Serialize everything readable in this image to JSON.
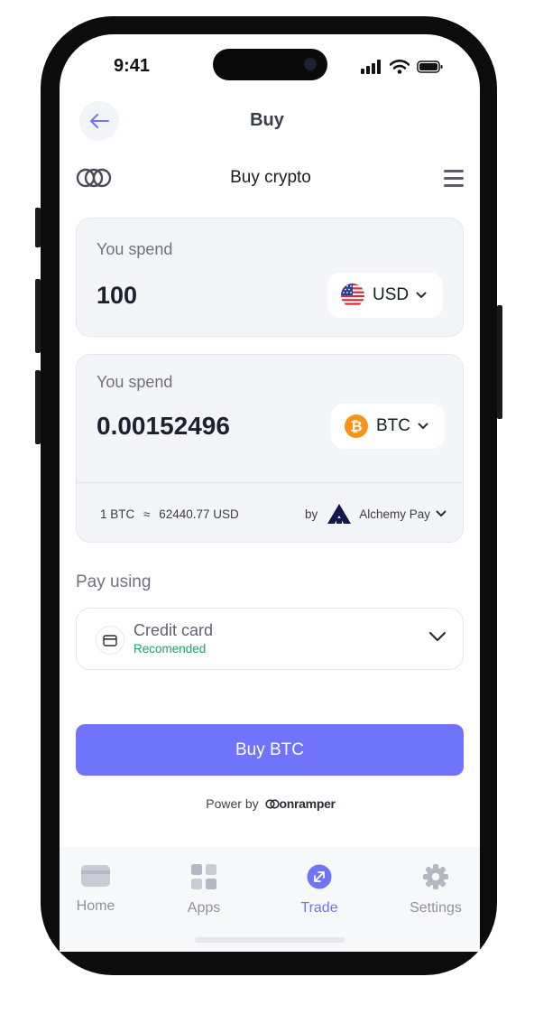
{
  "status_bar": {
    "time": "9:41"
  },
  "nav": {
    "title": "Buy"
  },
  "widget": {
    "title": "Buy crypto"
  },
  "spend": {
    "label": "You spend",
    "amount": "100",
    "currency": "USD"
  },
  "receive": {
    "label": "You spend",
    "amount": "0.00152496",
    "currency": "BTC",
    "rate_left": "1 BTC",
    "rate_symbol": "≈",
    "rate_right": "62440.77 USD",
    "provider_prefix": "by",
    "provider_name": "Alchemy Pay"
  },
  "payment": {
    "label": "Pay using",
    "method": "Credit card",
    "badge": "Recomended"
  },
  "buy_button": {
    "label": "Buy BTC"
  },
  "powered_by": {
    "prefix": "Power by",
    "brand": "onramper"
  },
  "tabs": [
    {
      "label": "Home",
      "icon": "card-icon"
    },
    {
      "label": "Apps",
      "icon": "grid-icon"
    },
    {
      "label": "Trade",
      "icon": "trade-icon",
      "active": true
    },
    {
      "label": "Settings",
      "icon": "gear-icon"
    }
  ],
  "colors": {
    "accent": "#6f74fb",
    "recommended": "#1fa260",
    "bitcoin": "#f7931a",
    "card_bg": "#f4f5f8"
  }
}
